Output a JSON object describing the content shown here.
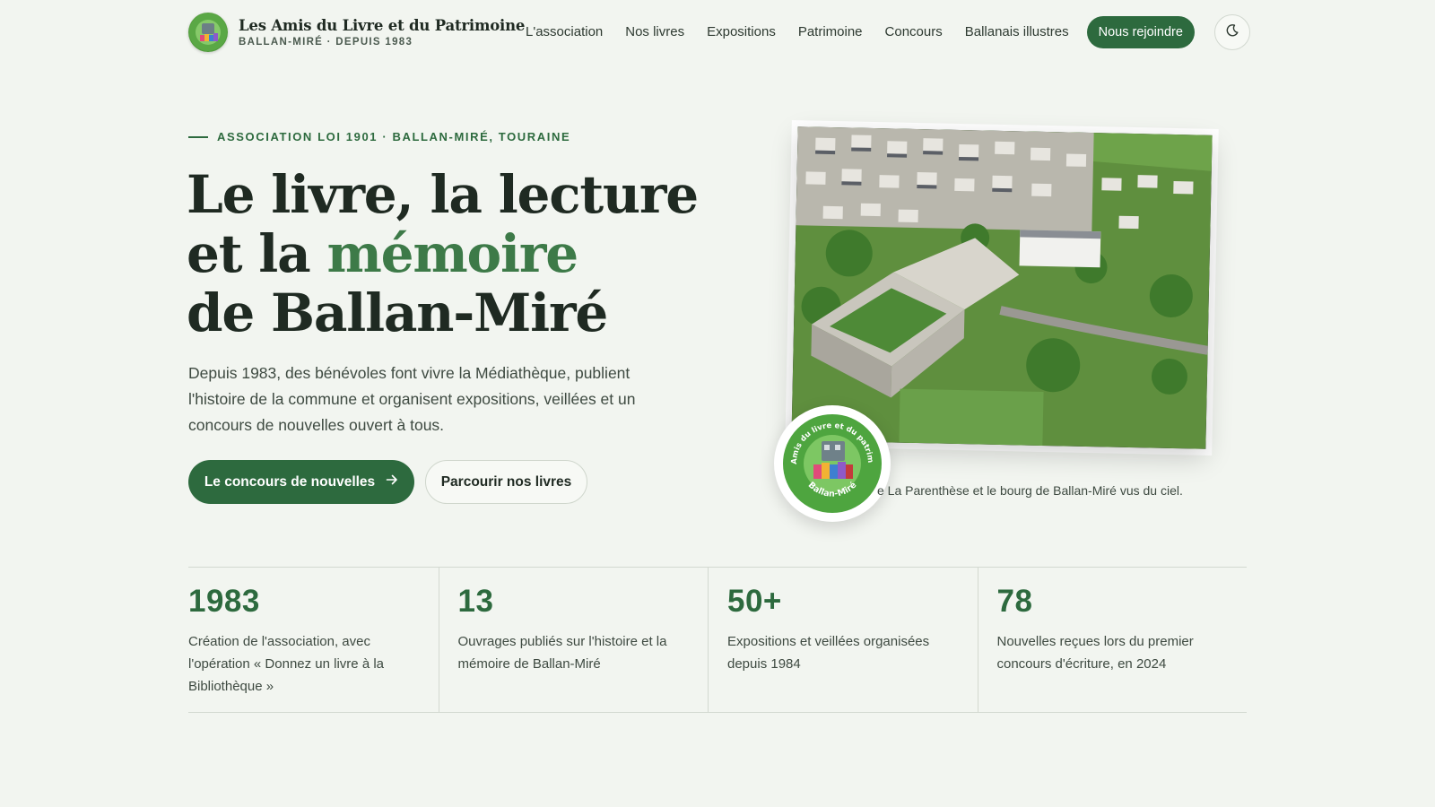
{
  "colors": {
    "background": "#f2f5f0",
    "accent": "#2d6a3e",
    "accent_light": "#3d7a48",
    "text": "#1f2a22"
  },
  "brand": {
    "logo_icon": "association-logo",
    "title": "Les Amis du Livre et du Patrimoine",
    "subtitle": "BALLAN-MIRÉ · DEPUIS 1983"
  },
  "nav": {
    "items": [
      {
        "label": "L'association"
      },
      {
        "label": "Nos livres"
      },
      {
        "label": "Expositions"
      },
      {
        "label": "Patrimoine"
      },
      {
        "label": "Concours"
      },
      {
        "label": "Ballanais illustres"
      }
    ],
    "cta": "Nous rejoindre",
    "theme_toggle_icon": "moon-icon"
  },
  "hero": {
    "eyebrow": "ASSOCIATION LOI 1901 · BALLAN-MIRÉ, TOURAINE",
    "headline_line1": "Le livre, la lecture",
    "headline_line2_prefix": "et la ",
    "headline_line2_accent": "mémoire",
    "headline_line3": "de Ballan-Miré",
    "lede": "Depuis 1983, des bénévoles font vivre la Médiathèque, publient l'histoire de la commune et organisent expositions, veillées et un concours de nouvelles ouvert à tous.",
    "primary_button": "Le concours de nouvelles",
    "primary_button_icon": "arrow-right-icon",
    "secondary_button": "Parcourir nos livres"
  },
  "photo": {
    "caption": "e La Parenthèse et le bourg de Ballan-Miré vus du ciel.",
    "seal_text_top": "Les Amis du livre et du patrimoine",
    "seal_text_bottom": "Ballan-Miré"
  },
  "stats": [
    {
      "value": "1983",
      "label": "Création de l'association, avec l'opération « Donnez un livre à la Bibliothèque »"
    },
    {
      "value": "13",
      "label": "Ouvrages publiés sur l'histoire et la mémoire de Ballan-Miré"
    },
    {
      "value": "50+",
      "label": "Expositions et veillées organisées depuis 1984"
    },
    {
      "value": "78",
      "label": "Nouvelles reçues lors du premier concours d'écriture, en 2024"
    }
  ]
}
